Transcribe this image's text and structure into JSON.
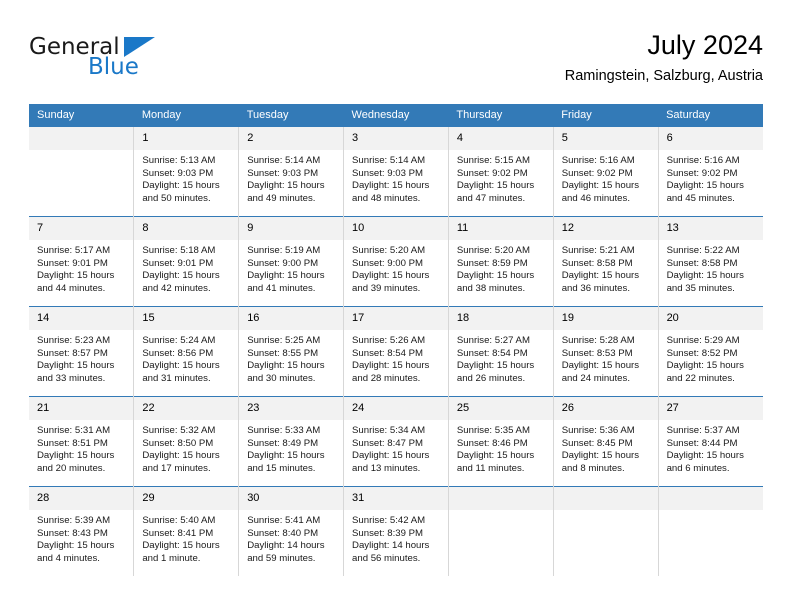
{
  "brand": {
    "name_part1": "General",
    "name_part2": "Blue",
    "triangle_icon": "brand-triangle-icon",
    "accent_color": "#1a78c8"
  },
  "header": {
    "title": "July 2024",
    "subtitle": "Ramingstein, Salzburg, Austria"
  },
  "calendar": {
    "header_bg": "#337ab7",
    "daynum_bg": "#f2f2f2",
    "weekday_headers": [
      "Sunday",
      "Monday",
      "Tuesday",
      "Wednesday",
      "Thursday",
      "Friday",
      "Saturday"
    ],
    "weeks": [
      [
        {
          "day": "",
          "lines": [
            "",
            "",
            "",
            ""
          ]
        },
        {
          "day": "1",
          "lines": [
            "Sunrise: 5:13 AM",
            "Sunset: 9:03 PM",
            "Daylight: 15 hours",
            "and 50 minutes."
          ]
        },
        {
          "day": "2",
          "lines": [
            "Sunrise: 5:14 AM",
            "Sunset: 9:03 PM",
            "Daylight: 15 hours",
            "and 49 minutes."
          ]
        },
        {
          "day": "3",
          "lines": [
            "Sunrise: 5:14 AM",
            "Sunset: 9:03 PM",
            "Daylight: 15 hours",
            "and 48 minutes."
          ]
        },
        {
          "day": "4",
          "lines": [
            "Sunrise: 5:15 AM",
            "Sunset: 9:02 PM",
            "Daylight: 15 hours",
            "and 47 minutes."
          ]
        },
        {
          "day": "5",
          "lines": [
            "Sunrise: 5:16 AM",
            "Sunset: 9:02 PM",
            "Daylight: 15 hours",
            "and 46 minutes."
          ]
        },
        {
          "day": "6",
          "lines": [
            "Sunrise: 5:16 AM",
            "Sunset: 9:02 PM",
            "Daylight: 15 hours",
            "and 45 minutes."
          ]
        }
      ],
      [
        {
          "day": "7",
          "lines": [
            "Sunrise: 5:17 AM",
            "Sunset: 9:01 PM",
            "Daylight: 15 hours",
            "and 44 minutes."
          ]
        },
        {
          "day": "8",
          "lines": [
            "Sunrise: 5:18 AM",
            "Sunset: 9:01 PM",
            "Daylight: 15 hours",
            "and 42 minutes."
          ]
        },
        {
          "day": "9",
          "lines": [
            "Sunrise: 5:19 AM",
            "Sunset: 9:00 PM",
            "Daylight: 15 hours",
            "and 41 minutes."
          ]
        },
        {
          "day": "10",
          "lines": [
            "Sunrise: 5:20 AM",
            "Sunset: 9:00 PM",
            "Daylight: 15 hours",
            "and 39 minutes."
          ]
        },
        {
          "day": "11",
          "lines": [
            "Sunrise: 5:20 AM",
            "Sunset: 8:59 PM",
            "Daylight: 15 hours",
            "and 38 minutes."
          ]
        },
        {
          "day": "12",
          "lines": [
            "Sunrise: 5:21 AM",
            "Sunset: 8:58 PM",
            "Daylight: 15 hours",
            "and 36 minutes."
          ]
        },
        {
          "day": "13",
          "lines": [
            "Sunrise: 5:22 AM",
            "Sunset: 8:58 PM",
            "Daylight: 15 hours",
            "and 35 minutes."
          ]
        }
      ],
      [
        {
          "day": "14",
          "lines": [
            "Sunrise: 5:23 AM",
            "Sunset: 8:57 PM",
            "Daylight: 15 hours",
            "and 33 minutes."
          ]
        },
        {
          "day": "15",
          "lines": [
            "Sunrise: 5:24 AM",
            "Sunset: 8:56 PM",
            "Daylight: 15 hours",
            "and 31 minutes."
          ]
        },
        {
          "day": "16",
          "lines": [
            "Sunrise: 5:25 AM",
            "Sunset: 8:55 PM",
            "Daylight: 15 hours",
            "and 30 minutes."
          ]
        },
        {
          "day": "17",
          "lines": [
            "Sunrise: 5:26 AM",
            "Sunset: 8:54 PM",
            "Daylight: 15 hours",
            "and 28 minutes."
          ]
        },
        {
          "day": "18",
          "lines": [
            "Sunrise: 5:27 AM",
            "Sunset: 8:54 PM",
            "Daylight: 15 hours",
            "and 26 minutes."
          ]
        },
        {
          "day": "19",
          "lines": [
            "Sunrise: 5:28 AM",
            "Sunset: 8:53 PM",
            "Daylight: 15 hours",
            "and 24 minutes."
          ]
        },
        {
          "day": "20",
          "lines": [
            "Sunrise: 5:29 AM",
            "Sunset: 8:52 PM",
            "Daylight: 15 hours",
            "and 22 minutes."
          ]
        }
      ],
      [
        {
          "day": "21",
          "lines": [
            "Sunrise: 5:31 AM",
            "Sunset: 8:51 PM",
            "Daylight: 15 hours",
            "and 20 minutes."
          ]
        },
        {
          "day": "22",
          "lines": [
            "Sunrise: 5:32 AM",
            "Sunset: 8:50 PM",
            "Daylight: 15 hours",
            "and 17 minutes."
          ]
        },
        {
          "day": "23",
          "lines": [
            "Sunrise: 5:33 AM",
            "Sunset: 8:49 PM",
            "Daylight: 15 hours",
            "and 15 minutes."
          ]
        },
        {
          "day": "24",
          "lines": [
            "Sunrise: 5:34 AM",
            "Sunset: 8:47 PM",
            "Daylight: 15 hours",
            "and 13 minutes."
          ]
        },
        {
          "day": "25",
          "lines": [
            "Sunrise: 5:35 AM",
            "Sunset: 8:46 PM",
            "Daylight: 15 hours",
            "and 11 minutes."
          ]
        },
        {
          "day": "26",
          "lines": [
            "Sunrise: 5:36 AM",
            "Sunset: 8:45 PM",
            "Daylight: 15 hours",
            "and 8 minutes."
          ]
        },
        {
          "day": "27",
          "lines": [
            "Sunrise: 5:37 AM",
            "Sunset: 8:44 PM",
            "Daylight: 15 hours",
            "and 6 minutes."
          ]
        }
      ],
      [
        {
          "day": "28",
          "lines": [
            "Sunrise: 5:39 AM",
            "Sunset: 8:43 PM",
            "Daylight: 15 hours",
            "and 4 minutes."
          ]
        },
        {
          "day": "29",
          "lines": [
            "Sunrise: 5:40 AM",
            "Sunset: 8:41 PM",
            "Daylight: 15 hours",
            "and 1 minute."
          ]
        },
        {
          "day": "30",
          "lines": [
            "Sunrise: 5:41 AM",
            "Sunset: 8:40 PM",
            "Daylight: 14 hours",
            "and 59 minutes."
          ]
        },
        {
          "day": "31",
          "lines": [
            "Sunrise: 5:42 AM",
            "Sunset: 8:39 PM",
            "Daylight: 14 hours",
            "and 56 minutes."
          ]
        },
        {
          "day": "",
          "lines": [
            "",
            "",
            "",
            ""
          ]
        },
        {
          "day": "",
          "lines": [
            "",
            "",
            "",
            ""
          ]
        },
        {
          "day": "",
          "lines": [
            "",
            "",
            "",
            ""
          ]
        }
      ]
    ]
  }
}
